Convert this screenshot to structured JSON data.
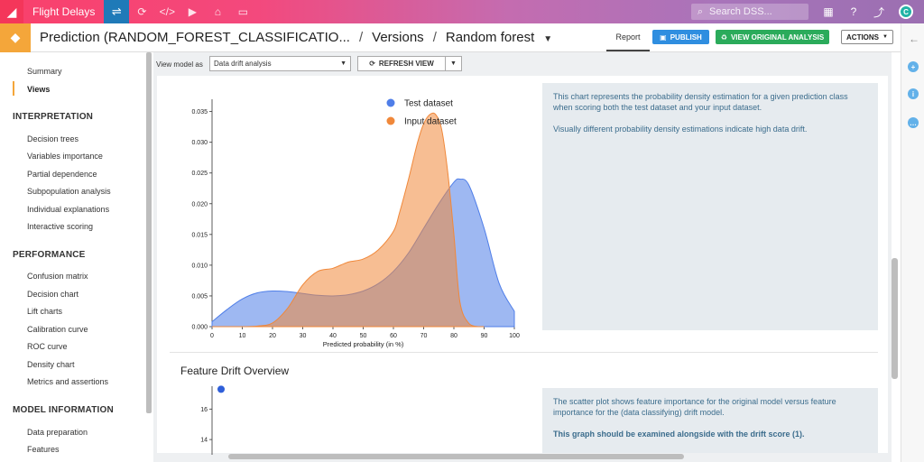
{
  "topbar": {
    "project": "Flight Delays",
    "search_placeholder": "Search DSS...",
    "icons": [
      "flow-icon",
      "recipe-icon",
      "code-icon",
      "run-icon",
      "dashboard-icon",
      "wiki-icon",
      "apps-icon",
      "help-icon",
      "activity-icon",
      "avatar"
    ],
    "avatar_letter": "C",
    "colors": {
      "left": "#f9406b",
      "right": "#9b6fb1",
      "flow": "#1f7ab8"
    }
  },
  "header": {
    "model": "Prediction (RANDOM_FOREST_CLASSIFICATIO...",
    "sep1": "/",
    "versions": "Versions",
    "sep2": "/",
    "current": "Random forest",
    "tab_report": "Report",
    "publish": "PUBLISH",
    "view_original": "VIEW ORIGINAL ANALYSIS",
    "actions": "ACTIONS"
  },
  "sidebar": {
    "top_items": [
      "Summary",
      "Views"
    ],
    "interpretation_title": "INTERPRETATION",
    "interpretation": [
      "Decision trees",
      "Variables importance",
      "Partial dependence",
      "Subpopulation analysis",
      "Individual explanations",
      "Interactive scoring"
    ],
    "performance_title": "PERFORMANCE",
    "performance": [
      "Confusion matrix",
      "Decision chart",
      "Lift charts",
      "Calibration curve",
      "ROC curve",
      "Density chart",
      "Metrics and assertions"
    ],
    "model_info_title": "MODEL INFORMATION",
    "model_info": [
      "Data preparation",
      "Features"
    ]
  },
  "toolbar": {
    "view_label": "View model as",
    "view_value": "Data drift analysis",
    "refresh": "REFRESH VIEW"
  },
  "density_desc": {
    "p1": "This chart represents the probability density estimation for a given prediction class when scoring both the test dataset and your input dataset.",
    "p2": "Visually different probability density estimations indicate high data drift."
  },
  "feature_drift": {
    "title": "Feature Drift Overview",
    "p1": "The scatter plot shows feature importance for the original model versus feature importance for the (data classifying) drift model.",
    "p2": "This graph should be examined alongside with the drift score (1)."
  },
  "chart_data": [
    {
      "type": "area",
      "xlabel": "Predicted probability (in %)",
      "ylabel": "",
      "xlim": [
        0,
        100
      ],
      "ylim": [
        0,
        0.037
      ],
      "xticks": [
        "0",
        "10",
        "20",
        "30",
        "40",
        "50",
        "60",
        "70",
        "80",
        "90",
        "100"
      ],
      "yticks": [
        "0.000",
        "0.005",
        "0.010",
        "0.015",
        "0.020",
        "0.025",
        "0.030",
        "0.035"
      ],
      "legend_position": "top",
      "series": [
        {
          "name": "Test dataset",
          "color": "#4f7ee8",
          "x": [
            0,
            5,
            10,
            15,
            20,
            25,
            30,
            35,
            40,
            45,
            50,
            55,
            60,
            65,
            70,
            75,
            80,
            82,
            85,
            90,
            95,
            100
          ],
          "y": [
            0.0008,
            0.0028,
            0.0045,
            0.0055,
            0.0058,
            0.0057,
            0.0054,
            0.0051,
            0.005,
            0.0052,
            0.0058,
            0.007,
            0.009,
            0.012,
            0.016,
            0.02,
            0.0235,
            0.024,
            0.023,
            0.016,
            0.007,
            0.0025
          ]
        },
        {
          "name": "Input dataset",
          "color": "#f0883a",
          "x": [
            0,
            10,
            15,
            20,
            25,
            30,
            35,
            40,
            45,
            50,
            55,
            60,
            62,
            65,
            68,
            70,
            72,
            74,
            76,
            78,
            80,
            82,
            85,
            88,
            90
          ],
          "y": [
            0.0,
            0.0,
            0.0001,
            0.0006,
            0.003,
            0.0068,
            0.009,
            0.0095,
            0.0105,
            0.011,
            0.0125,
            0.0155,
            0.0185,
            0.024,
            0.03,
            0.033,
            0.0345,
            0.0345,
            0.032,
            0.025,
            0.015,
            0.004,
            0.0005,
            0.0,
            0.0
          ]
        }
      ]
    },
    {
      "type": "scatter",
      "ylim": [
        13,
        17.5
      ],
      "yticks": [
        "16",
        "14"
      ],
      "series": [
        {
          "name": "",
          "color": "#2f5fd9",
          "points": [
            {
              "x": 0,
              "y": 17.3
            }
          ]
        }
      ]
    }
  ]
}
